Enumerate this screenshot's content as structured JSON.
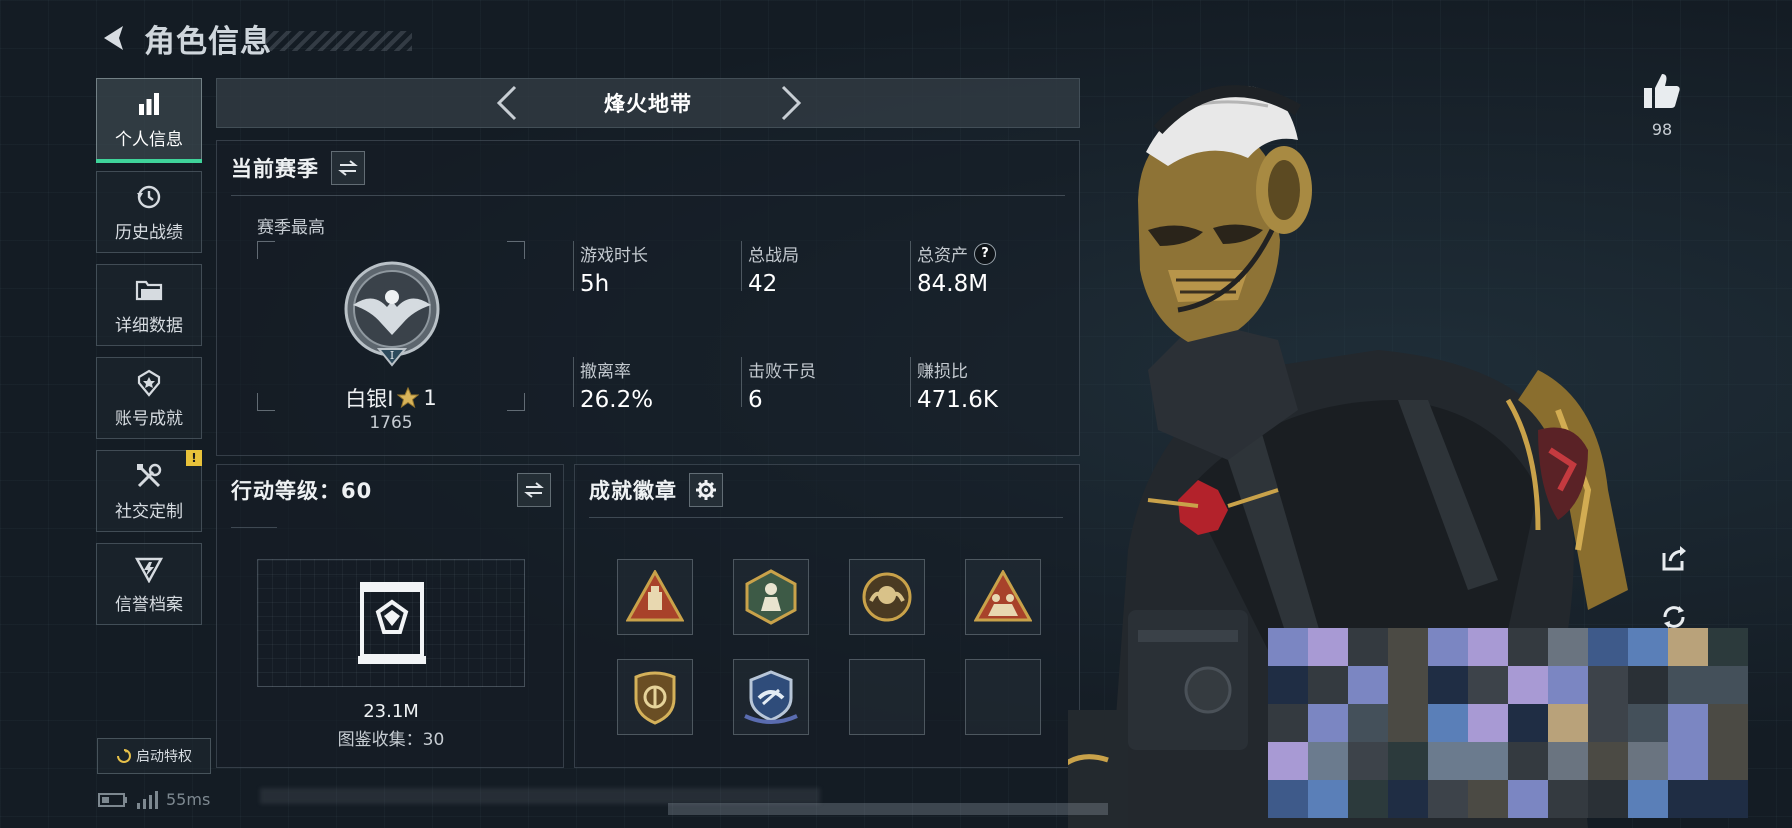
{
  "header": {
    "title": "角色信息",
    "back_icon": "back-arrow-icon"
  },
  "sidebar": {
    "items": [
      {
        "label": "个人信息",
        "icon": "bar-chart-icon",
        "active": true
      },
      {
        "label": "历史战绩",
        "icon": "history-icon"
      },
      {
        "label": "详细数据",
        "icon": "folder-icon"
      },
      {
        "label": "账号成就",
        "icon": "achievement-icon"
      },
      {
        "label": "社交定制",
        "icon": "tools-icon",
        "badge": "!"
      },
      {
        "label": "信誉档案",
        "icon": "credit-shield-icon"
      }
    ],
    "privilege_label": "启动特权"
  },
  "status": {
    "ping": "55ms"
  },
  "mode": {
    "title": "烽火地带"
  },
  "season": {
    "title": "当前赛季",
    "best_label": "赛季最高",
    "rank_name": "白银I",
    "rank_stars": "1",
    "rank_score": "1765",
    "stats": [
      {
        "label": "游戏时长",
        "value": "5h"
      },
      {
        "label": "总战局",
        "value": "42"
      },
      {
        "label": "总资产",
        "value": "84.8M",
        "help": "?"
      },
      {
        "label": "撤离率",
        "value": "26.2%"
      },
      {
        "label": "击败干员",
        "value": "6"
      },
      {
        "label": "赚损比",
        "value": "471.6K"
      }
    ]
  },
  "action_level": {
    "title": "行动等级：60",
    "codex_value": "23.1M",
    "codex_count": "图鉴收集：30"
  },
  "badges": {
    "title": "成就徽章",
    "items": [
      "triangle-supply-badge",
      "hexagon-soldier-badge",
      "round-emblem-badge",
      "triangle-squad-badge",
      "shield-badge",
      "winged-crest-badge",
      "empty-slot",
      "empty-slot"
    ]
  },
  "social": {
    "likes": "98"
  },
  "colors": {
    "accent": "#3fd39a",
    "warning": "#e8c23a",
    "gold": "#c9a24a",
    "background": "#141c24"
  }
}
